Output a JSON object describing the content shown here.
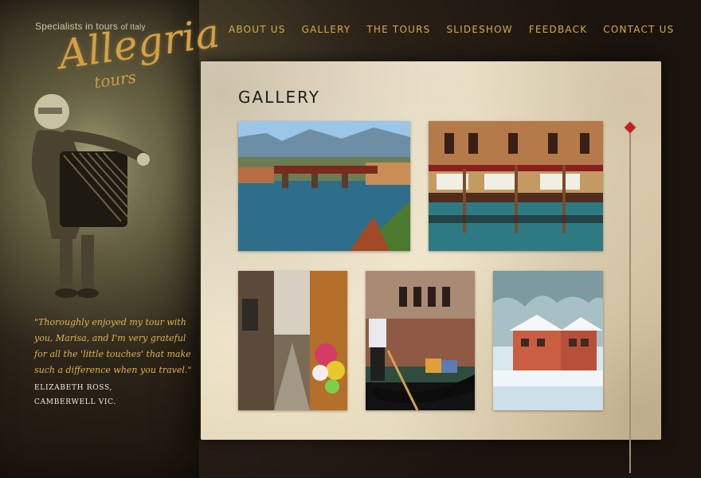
{
  "brand": {
    "tagline_left": "Specialists in tours",
    "tagline_right": "of Italy",
    "logo_word": "Allegria",
    "logo_sub": "tours"
  },
  "nav": {
    "items": [
      {
        "label": "ABOUT US"
      },
      {
        "label": "GALLERY"
      },
      {
        "label": "THE TOURS"
      },
      {
        "label": "SLIDESHOW"
      },
      {
        "label": "FEEDBACK"
      },
      {
        "label": "CONTACT US"
      }
    ]
  },
  "testimonial": {
    "quote": "\"Thoroughly enjoyed my tour with you, Marisa, and I'm very grateful for all the 'little touches' that make such a difference when you travel.\"",
    "author_name": "ELIZABETH ROSS,",
    "author_location": "CAMBERWELL VIC."
  },
  "gallery": {
    "title": "GALLERY"
  },
  "colors": {
    "accent_gold": "#d8aa45",
    "scroll_red": "#c61f1f",
    "panel_parchment": "#efe5cc",
    "background_dark": "#1f150f"
  },
  "icons": {
    "scroll_thumb": "diamond-icon"
  }
}
